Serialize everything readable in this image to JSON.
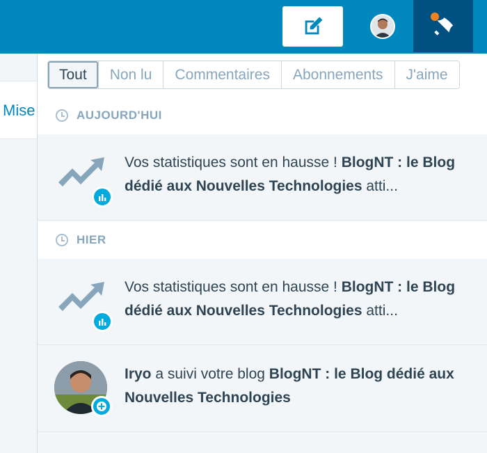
{
  "left_page": {
    "link_text": "Mise"
  },
  "filters": [
    {
      "label": "Tout",
      "active": true
    },
    {
      "label": "Non lu",
      "active": false
    },
    {
      "label": "Commentaires",
      "active": false
    },
    {
      "label": "Abonnements",
      "active": false
    },
    {
      "label": "J'aime",
      "active": false
    }
  ],
  "sections": {
    "today": {
      "label": "AUJOURD'HUI"
    },
    "yesterday": {
      "label": "HIER"
    }
  },
  "notifications": [
    {
      "type": "stats",
      "pre": "Vos statistiques sont en hausse ! ",
      "blog": "BlogNT : le Blog dédié aux Nouvelles Technologies",
      "post": " atti..."
    },
    {
      "type": "stats",
      "pre": "Vos statistiques sont en hausse ! ",
      "blog": "BlogNT : le Blog dédié aux Nouvelles Technologies",
      "post": " atti..."
    },
    {
      "type": "follow",
      "user": "Iryo",
      "pre": " a suivi votre blog ",
      "blog": "BlogNT : le Blog dédié aux Nouvelles Technologies"
    }
  ],
  "icons": {
    "write": "pencil-square-icon",
    "notifications": "bell-icon",
    "stats": "trending-up-icon",
    "stats_badge": "bar-chart-icon",
    "follow_badge": "plus-icon",
    "clock": "clock-icon"
  },
  "colors": {
    "topbar": "#0087be",
    "badge": "#00aadc",
    "notif_dot": "#f0821e",
    "active_tab": "#005082"
  }
}
